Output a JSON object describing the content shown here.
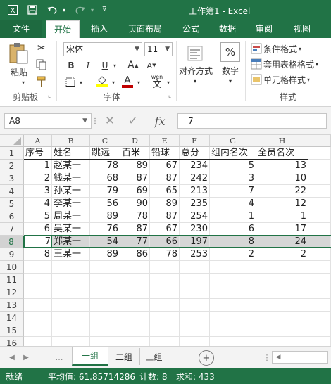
{
  "title_bar": {
    "title": "工作簿1 - Excel"
  },
  "menu_tabs": [
    "文件",
    "开始",
    "插入",
    "页面布局",
    "公式",
    "数据",
    "审阅",
    "视图"
  ],
  "ribbon": {
    "paste_label": "粘贴",
    "clipboard_label": "剪贴板",
    "font_name": "宋体",
    "font_size": "11",
    "font_group_label": "字体",
    "bold": "B",
    "italic": "I",
    "underline": "U",
    "font_color_letter": "A",
    "font_grow": "A",
    "font_shrink": "A",
    "wen": "wén",
    "wen_char": "文",
    "align_label": "对齐方式",
    "number_label": "数字",
    "percent": "%",
    "cond_format": "条件格式",
    "table_format": "套用表格格式",
    "cell_style": "单元格样式",
    "styles_label": "样式",
    "colors": {
      "fill": "#ffff00",
      "font": "#c00000"
    }
  },
  "formula_bar": {
    "name_box": "A8",
    "value": "7",
    "fx": "fx"
  },
  "columns": [
    "A",
    "B",
    "C",
    "D",
    "E",
    "F",
    "G",
    "H"
  ],
  "row_numbers": [
    "1",
    "2",
    "3",
    "4",
    "5",
    "6",
    "7",
    "8",
    "9",
    "10",
    "11",
    "12",
    "13",
    "14",
    "15",
    "16"
  ],
  "header_row": [
    "序号",
    "姓名",
    "跳远",
    "百米",
    "铅球",
    "总分",
    "组内名次",
    "全员名次"
  ],
  "data_rows": [
    [
      "1",
      "赵某一",
      "78",
      "89",
      "67",
      "234",
      "5",
      "13"
    ],
    [
      "2",
      "钱某一",
      "68",
      "87",
      "87",
      "242",
      "3",
      "10"
    ],
    [
      "3",
      "孙某一",
      "79",
      "69",
      "65",
      "213",
      "7",
      "22"
    ],
    [
      "4",
      "李某一",
      "56",
      "90",
      "89",
      "235",
      "4",
      "12"
    ],
    [
      "5",
      "周某一",
      "89",
      "78",
      "87",
      "254",
      "1",
      "1"
    ],
    [
      "6",
      "吴某一",
      "76",
      "87",
      "67",
      "230",
      "6",
      "17"
    ],
    [
      "7",
      "郑某一",
      "54",
      "77",
      "66",
      "197",
      "8",
      "24"
    ],
    [
      "8",
      "王某一",
      "89",
      "86",
      "78",
      "253",
      "2",
      "2"
    ]
  ],
  "selected_row": "8",
  "sheet_tabs": [
    "一组",
    "二组",
    "三组"
  ],
  "status": {
    "ready": "就绪",
    "average": "平均值: 61.85714286",
    "count": "计数: 8",
    "sum": "求和: 433"
  },
  "accent": "#217346"
}
